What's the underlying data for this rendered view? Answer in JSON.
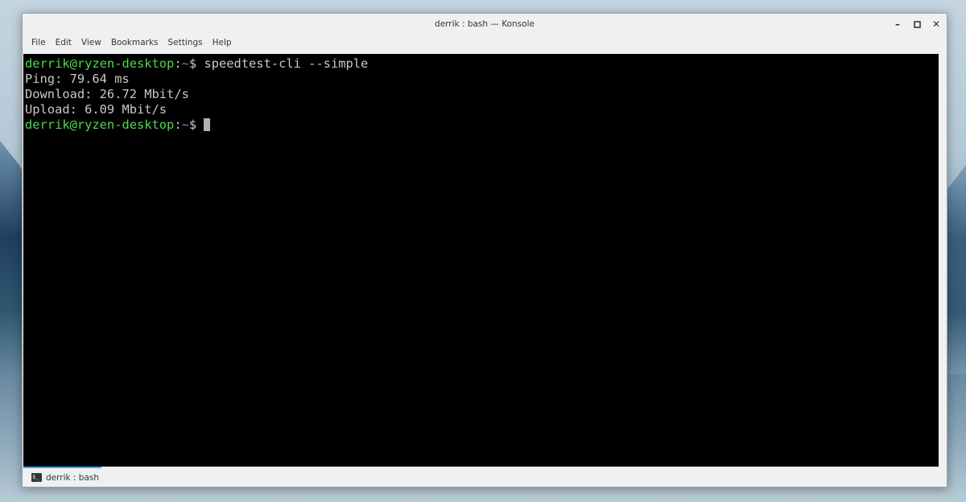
{
  "window": {
    "title": "derrik : bash — Konsole",
    "controls": {
      "minimize": "–",
      "maximize": "▫",
      "close": "✕"
    }
  },
  "menu": {
    "items": [
      "File",
      "Edit",
      "View",
      "Bookmarks",
      "Settings",
      "Help"
    ]
  },
  "terminal": {
    "lines": [
      {
        "user": "derrik@ryzen-desktop",
        "sep": ":",
        "path": "~",
        "sym": "$ ",
        "command": "speedtest-cli --simple"
      },
      {
        "output": "Ping: 79.64 ms"
      },
      {
        "output": "Download: 26.72 Mbit/s"
      },
      {
        "output": "Upload: 6.09 Mbit/s"
      },
      {
        "user": "derrik@ryzen-desktop",
        "sep": ":",
        "path": "~",
        "sym": "$ ",
        "command": ""
      }
    ]
  },
  "tabs": [
    {
      "label": "derrik : bash",
      "icon": "terminal-icon",
      "active": true
    }
  ],
  "colors": {
    "prompt_user": "#4cd94c",
    "prompt_path": "#5d8fe0",
    "active_tab_accent": "#3daee9"
  }
}
